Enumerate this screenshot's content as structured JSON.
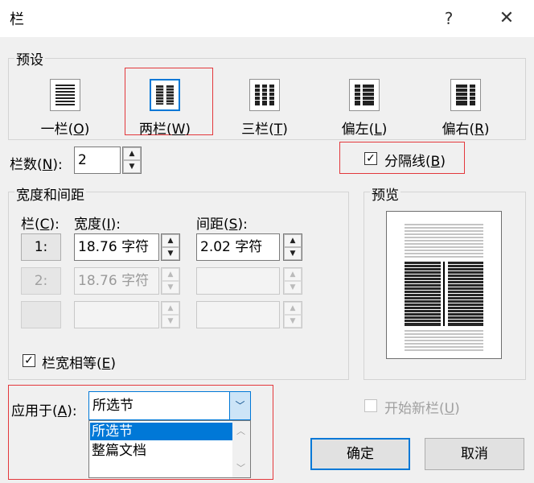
{
  "title": "栏",
  "titlebar": {
    "help_label": "?",
    "close_label": "✕"
  },
  "presets": {
    "legend": "预设",
    "items": [
      {
        "label": "一栏",
        "key": "O",
        "icon": "one-column-icon"
      },
      {
        "label": "两栏",
        "key": "W",
        "icon": "two-columns-icon"
      },
      {
        "label": "三栏",
        "key": "T",
        "icon": "three-columns-icon"
      },
      {
        "label": "偏左",
        "key": "L",
        "icon": "left-column-icon"
      },
      {
        "label": "偏右",
        "key": "R",
        "icon": "right-column-icon"
      }
    ],
    "selected": "两栏"
  },
  "column_count": {
    "label": "栏数",
    "key": "N",
    "value": "2"
  },
  "separator": {
    "label": "分隔线",
    "key": "B",
    "checked": true
  },
  "width_spacing": {
    "legend": "宽度和间距",
    "col_header": "栏",
    "col_key": "C",
    "width_header": "宽度",
    "width_key": "I",
    "spacing_header": "间距",
    "spacing_key": "S",
    "rows": [
      {
        "col": "1:",
        "width": "18.76 字符",
        "spacing": "2.02 字符"
      },
      {
        "col": "2:",
        "width": "18.76 字符",
        "spacing": ""
      },
      {
        "col": "",
        "width": "",
        "spacing": ""
      }
    ],
    "equal_width": {
      "label": "栏宽相等",
      "key": "E",
      "checked": true
    }
  },
  "preview": {
    "legend": "预览"
  },
  "apply_to": {
    "label": "应用于",
    "key": "A",
    "value": "所选节",
    "options": [
      "所选节",
      "整篇文档"
    ]
  },
  "start_new_column": {
    "label": "开始新栏",
    "key": "U",
    "checked": false
  },
  "buttons": {
    "ok": "确定",
    "cancel": "取消"
  },
  "colors": {
    "accent": "#0078d7",
    "highlight": "#e3383c"
  }
}
